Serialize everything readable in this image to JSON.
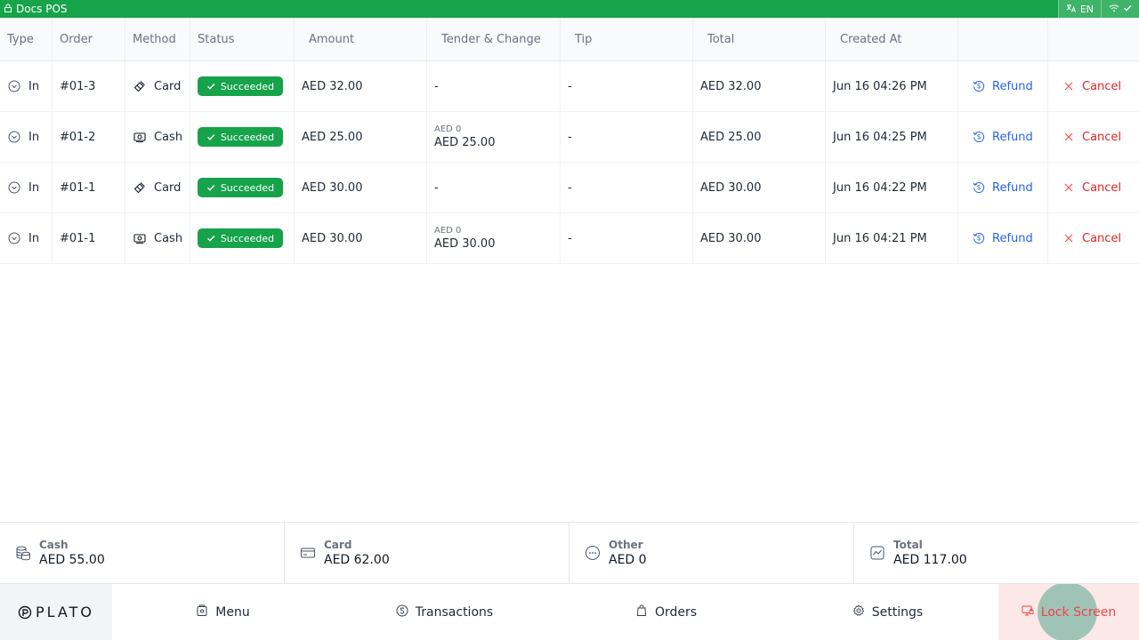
{
  "topbar": {
    "title": "Docs POS",
    "language": "EN"
  },
  "table": {
    "headers": {
      "type": "Type",
      "order": "Order",
      "method": "Method",
      "status": "Status",
      "amount": "Amount",
      "tender": "Tender & Change",
      "tip": "Tip",
      "total": "Total",
      "created": "Created At"
    },
    "rows": [
      {
        "type": "In",
        "order": "#01-3",
        "method": "Card",
        "method_icon": "card-icon",
        "status": "Succeeded",
        "amount": "AED 32.00",
        "tender_small": "",
        "tender": "-",
        "tip": "-",
        "total": "AED 32.00",
        "created": "Jun 16 04:26 PM",
        "refund": "Refund",
        "cancel": "Cancel"
      },
      {
        "type": "In",
        "order": "#01-2",
        "method": "Cash",
        "method_icon": "cash-icon",
        "status": "Succeeded",
        "amount": "AED 25.00",
        "tender_small": "AED 0",
        "tender": "AED 25.00",
        "tip": "-",
        "total": "AED 25.00",
        "created": "Jun 16 04:25 PM",
        "refund": "Refund",
        "cancel": "Cancel"
      },
      {
        "type": "In",
        "order": "#01-1",
        "method": "Card",
        "method_icon": "card-icon",
        "status": "Succeeded",
        "amount": "AED 30.00",
        "tender_small": "",
        "tender": "-",
        "tip": "-",
        "total": "AED 30.00",
        "created": "Jun 16 04:22 PM",
        "refund": "Refund",
        "cancel": "Cancel"
      },
      {
        "type": "In",
        "order": "#01-1",
        "method": "Cash",
        "method_icon": "cash-icon",
        "status": "Succeeded",
        "amount": "AED 30.00",
        "tender_small": "AED 0",
        "tender": "AED 30.00",
        "tip": "-",
        "total": "AED 30.00",
        "created": "Jun 16 04:21 PM",
        "refund": "Refund",
        "cancel": "Cancel"
      }
    ]
  },
  "summary": {
    "cash": {
      "label": "Cash",
      "value": "AED 55.00"
    },
    "card": {
      "label": "Card",
      "value": "AED 62.00"
    },
    "other": {
      "label": "Other",
      "value": "AED 0"
    },
    "total": {
      "label": "Total",
      "value": "AED 117.00"
    }
  },
  "nav": {
    "logo": "PLATO",
    "menu": "Menu",
    "transactions": "Transactions",
    "orders": "Orders",
    "settings": "Settings",
    "lock": "Lock Screen"
  },
  "colors": {
    "accent": "#16a34a",
    "refund": "#2563eb",
    "cancel": "#dc2626"
  }
}
